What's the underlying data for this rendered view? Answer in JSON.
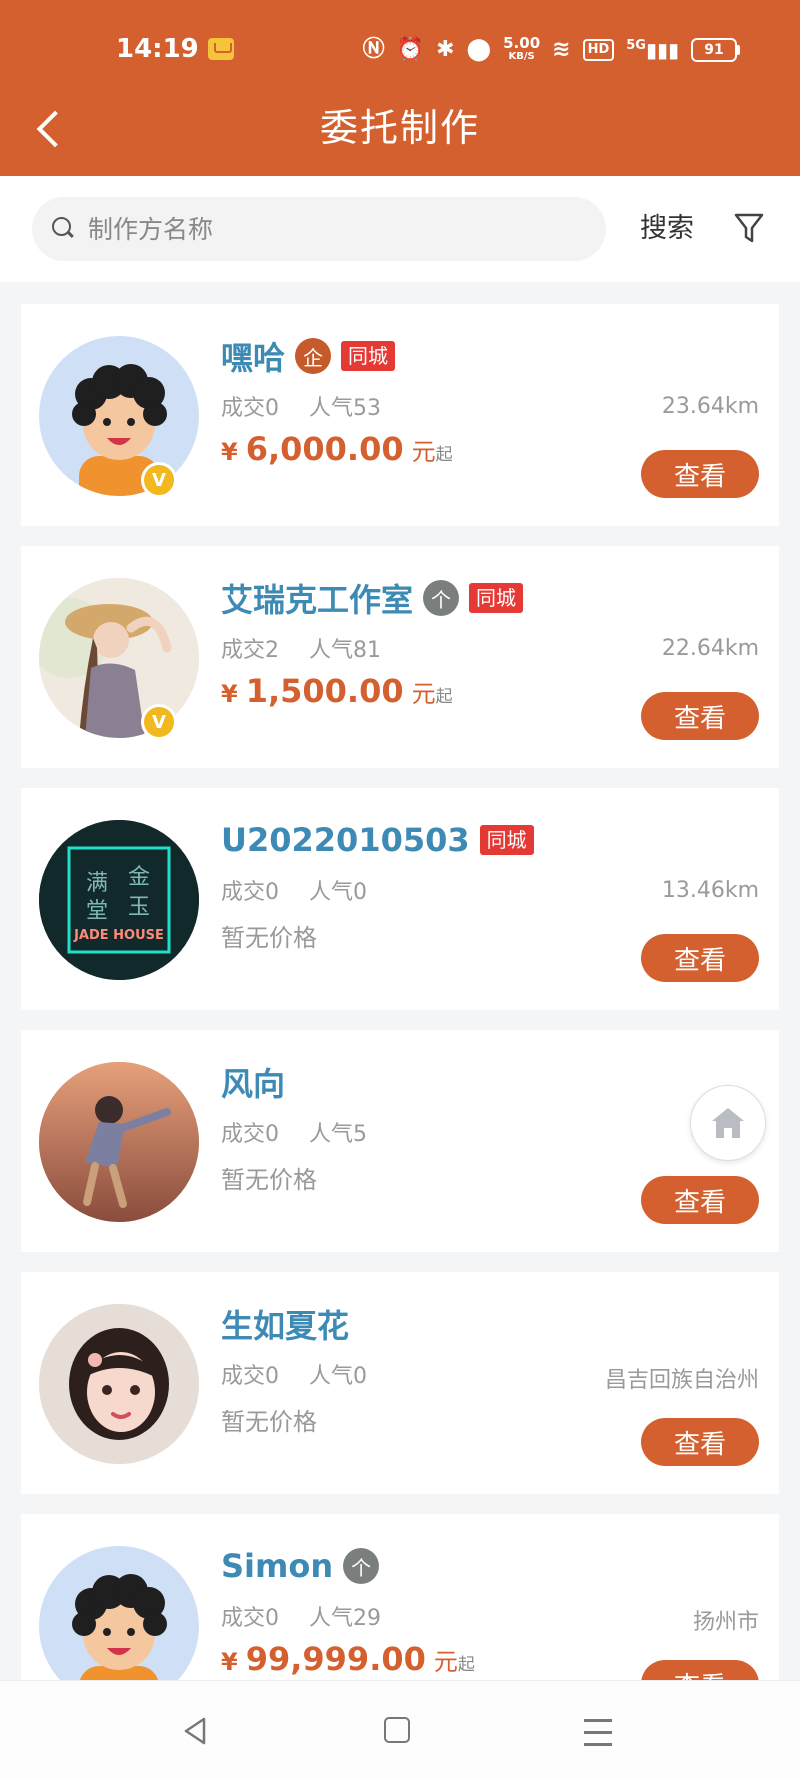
{
  "status_bar": {
    "time": "14:19",
    "speed_value": "5.00",
    "speed_unit": "KB/S",
    "hd": "HD",
    "signal": "5G",
    "battery": "91"
  },
  "header": {
    "title": "委托制作"
  },
  "search": {
    "placeholder": "制作方名称",
    "button_label": "搜索"
  },
  "cards": [
    {
      "name": "嘿哈",
      "badge": "企",
      "tag": "同城",
      "deals": "成交0",
      "popularity": "人气53",
      "price_symbol": "¥",
      "price": "6,000.00",
      "price_unit": "元",
      "price_suffix": "起",
      "distance": "23.64km",
      "button": "查看",
      "vip": "V"
    },
    {
      "name": "艾瑞克工作室",
      "badge": "个",
      "tag": "同城",
      "deals": "成交2",
      "popularity": "人气81",
      "price_symbol": "¥",
      "price": "1,500.00",
      "price_unit": "元",
      "price_suffix": "起",
      "distance": "22.64km",
      "button": "查看",
      "vip": "V"
    },
    {
      "name": "U2022010503",
      "tag": "同城",
      "deals": "成交0",
      "popularity": "人气0",
      "no_price": "暂无价格",
      "distance": "13.46km",
      "button": "查看",
      "avatar_text": "JADE HOUSE"
    },
    {
      "name": "风向",
      "deals": "成交0",
      "popularity": "人气5",
      "no_price": "暂无价格",
      "button": "查看"
    },
    {
      "name": "生如夏花",
      "deals": "成交0",
      "popularity": "人气0",
      "no_price": "暂无价格",
      "distance": "昌吉回族自治州",
      "button": "查看"
    },
    {
      "name": "Simon",
      "badge": "个",
      "deals": "成交0",
      "popularity": "人气29",
      "price_symbol": "¥",
      "price": "99,999.00",
      "price_unit": "元",
      "price_suffix": "起",
      "distance": "扬州市",
      "button": "查看"
    }
  ],
  "colors": {
    "brand": "#d4602f",
    "name": "#3d8ab5",
    "tag": "#e53935",
    "vip": "#f2b81f"
  },
  "icons": [
    "back-icon",
    "search-icon",
    "filter-icon",
    "home-icon",
    "nav-back-icon",
    "nav-home-icon",
    "nav-menu-icon"
  ]
}
